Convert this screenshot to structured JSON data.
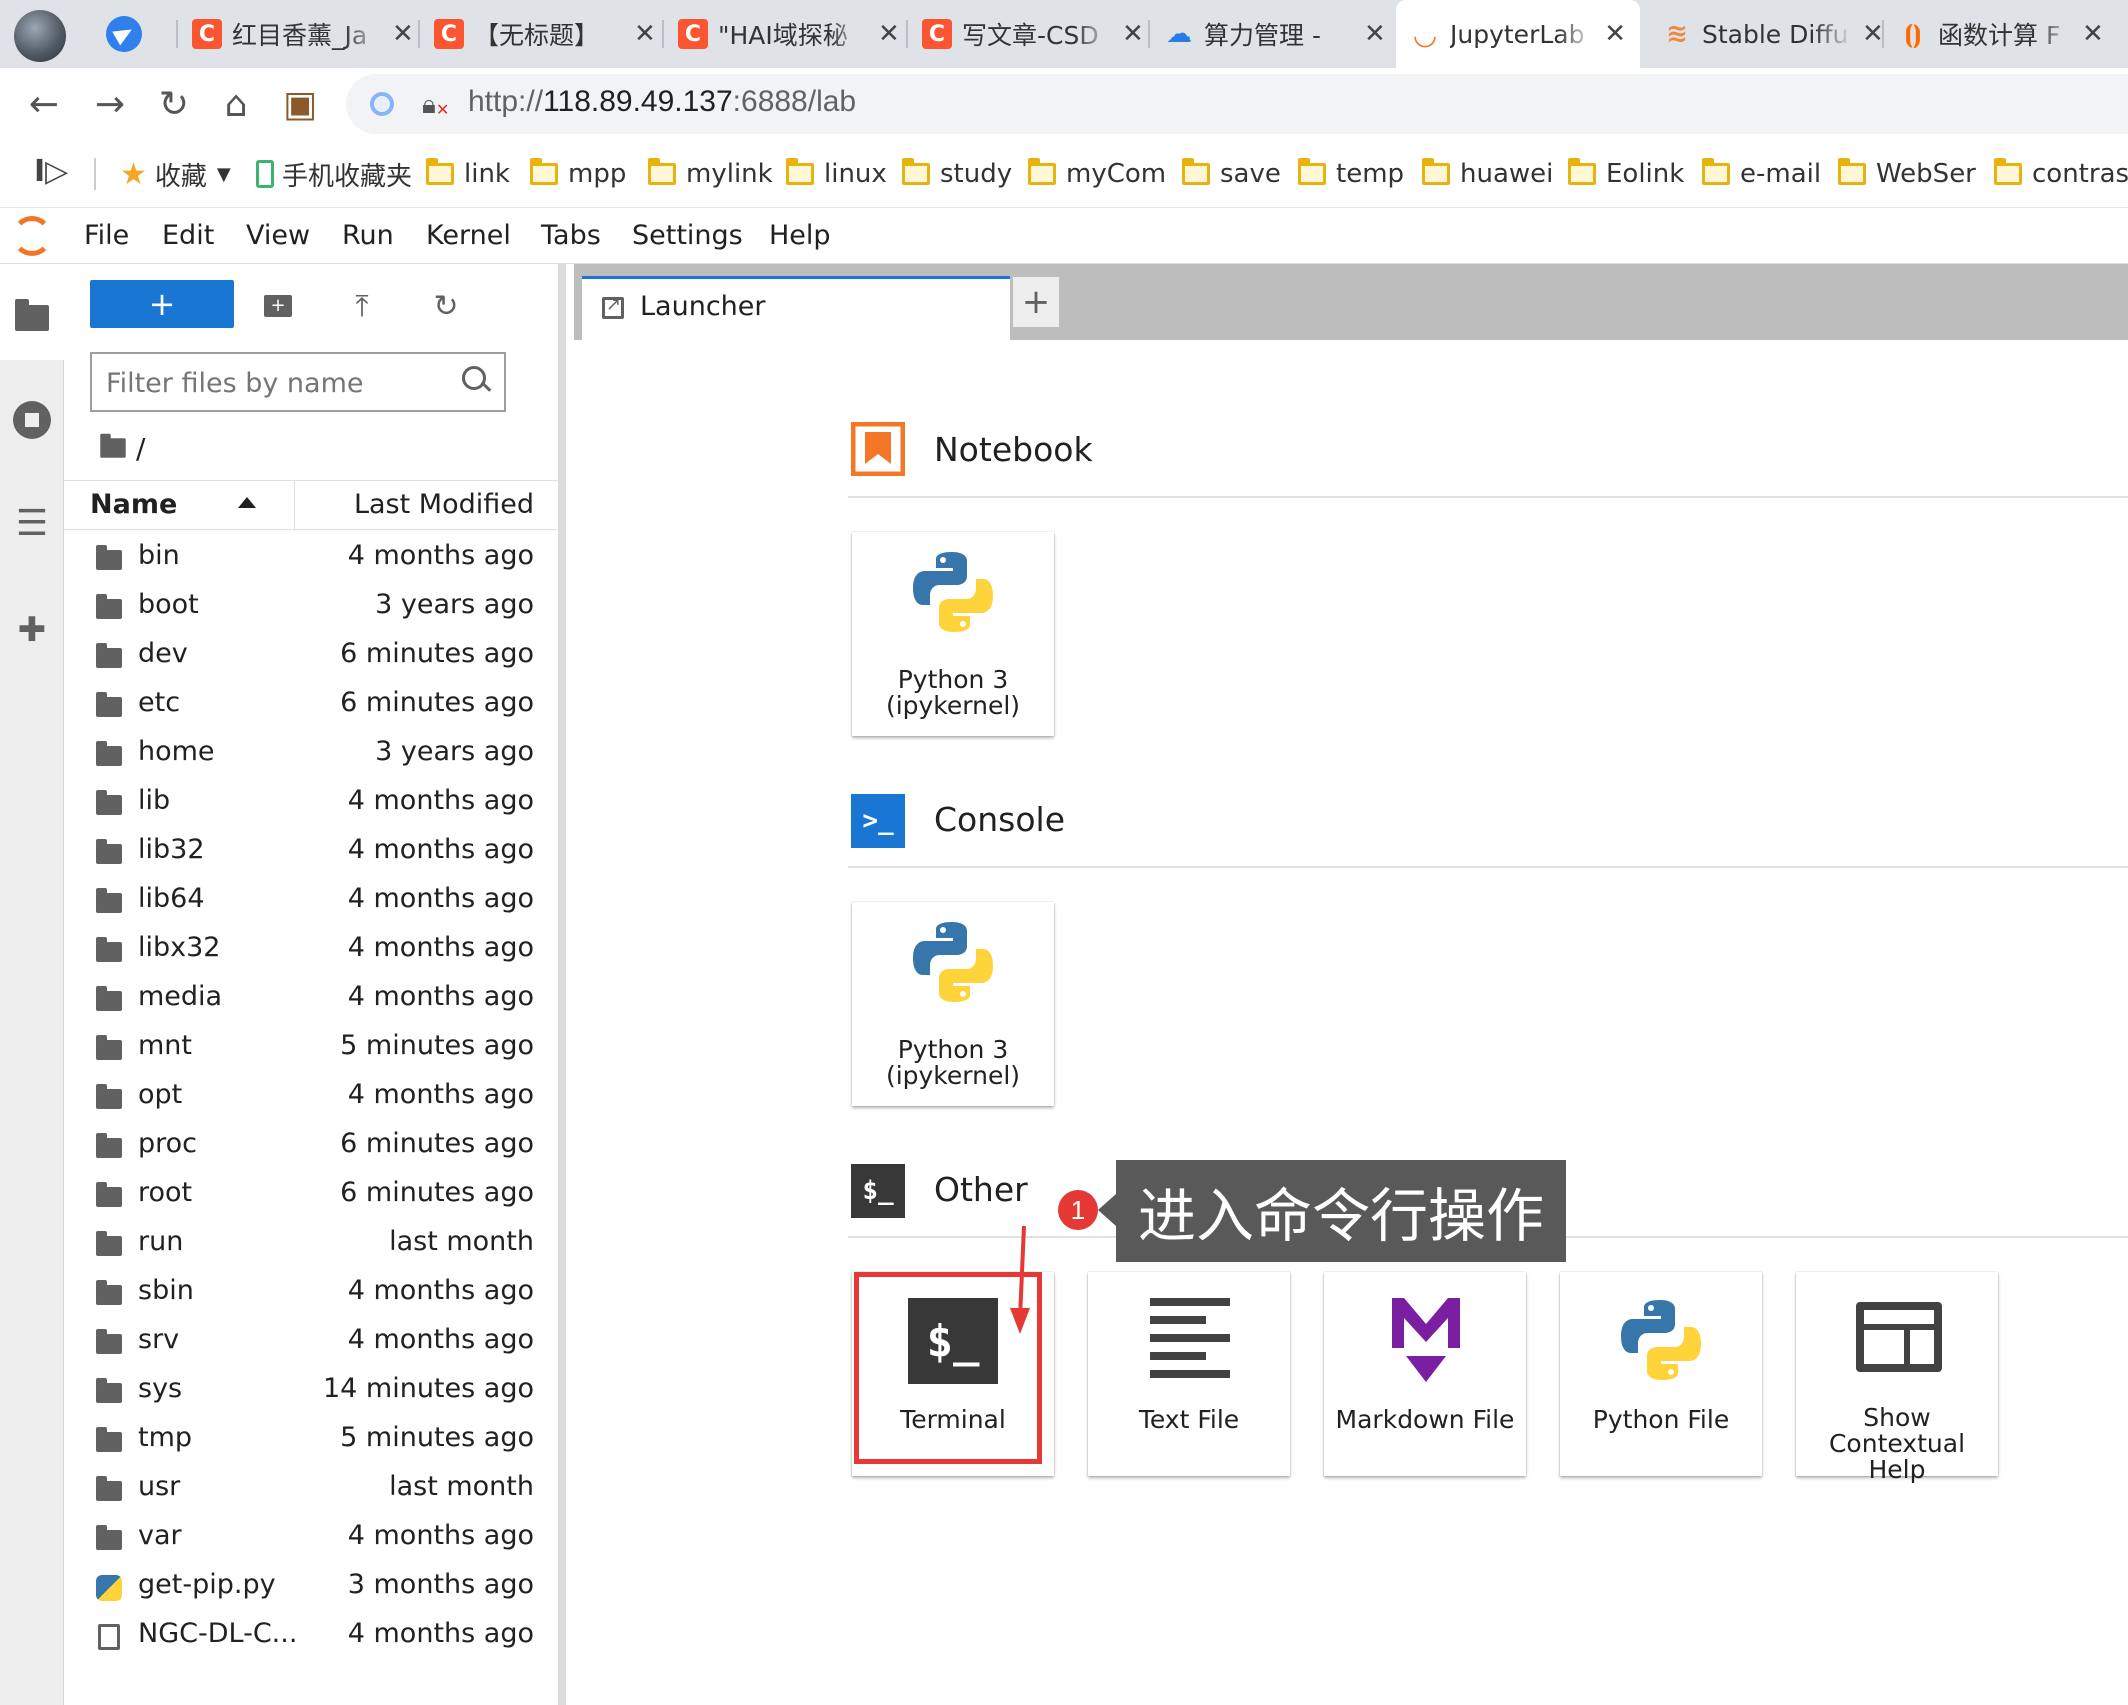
{
  "browser": {
    "tabs": [
      {
        "icon": "csdn-icon",
        "label": "红目香薰_Ja",
        "active": false
      },
      {
        "icon": "csdn-icon",
        "label": "【无标题】",
        "active": false
      },
      {
        "icon": "csdn-icon",
        "label": "\"HAI域探秘",
        "active": false
      },
      {
        "icon": "csdn-icon",
        "label": "写文章-CSD",
        "active": false
      },
      {
        "icon": "cloud-icon",
        "label": "算力管理 -",
        "active": false
      },
      {
        "icon": "jupyter-icon",
        "label": "JupyterLab",
        "active": true
      },
      {
        "icon": "stable-diffusion-icon",
        "label": "Stable Diffu",
        "active": false
      },
      {
        "icon": "function-compute-icon",
        "label": "函数计算 F",
        "active": false
      }
    ],
    "close_glyph": "✕",
    "url": {
      "prefix": "http://",
      "host": "118.89.49.137",
      "rest": ":6888/lab"
    },
    "bookmarks": {
      "favorites": "收藏",
      "mobile": "手机收藏夹",
      "folders": [
        "link",
        "mpp",
        "mylink",
        "linux",
        "study",
        "myCom",
        "save",
        "temp",
        "huawei",
        "Eolink",
        "e-mail",
        "WebSer",
        "contrast"
      ]
    }
  },
  "jupyter": {
    "menu": [
      "File",
      "Edit",
      "View",
      "Run",
      "Kernel",
      "Tabs",
      "Settings",
      "Help"
    ],
    "file_browser": {
      "new_button": "+",
      "filter_placeholder": "Filter files by name",
      "breadcrumb": "/",
      "columns": {
        "name": "Name",
        "modified": "Last Modified"
      },
      "items": [
        {
          "name": "bin",
          "modified": "4 months ago",
          "type": "folder"
        },
        {
          "name": "boot",
          "modified": "3 years ago",
          "type": "folder"
        },
        {
          "name": "dev",
          "modified": "6 minutes ago",
          "type": "folder"
        },
        {
          "name": "etc",
          "modified": "6 minutes ago",
          "type": "folder"
        },
        {
          "name": "home",
          "modified": "3 years ago",
          "type": "folder"
        },
        {
          "name": "lib",
          "modified": "4 months ago",
          "type": "folder"
        },
        {
          "name": "lib32",
          "modified": "4 months ago",
          "type": "folder"
        },
        {
          "name": "lib64",
          "modified": "4 months ago",
          "type": "folder"
        },
        {
          "name": "libx32",
          "modified": "4 months ago",
          "type": "folder"
        },
        {
          "name": "media",
          "modified": "4 months ago",
          "type": "folder"
        },
        {
          "name": "mnt",
          "modified": "5 minutes ago",
          "type": "folder"
        },
        {
          "name": "opt",
          "modified": "4 months ago",
          "type": "folder"
        },
        {
          "name": "proc",
          "modified": "6 minutes ago",
          "type": "folder"
        },
        {
          "name": "root",
          "modified": "6 minutes ago",
          "type": "folder"
        },
        {
          "name": "run",
          "modified": "last month",
          "type": "folder"
        },
        {
          "name": "sbin",
          "modified": "4 months ago",
          "type": "folder"
        },
        {
          "name": "srv",
          "modified": "4 months ago",
          "type": "folder"
        },
        {
          "name": "sys",
          "modified": "14 minutes ago",
          "type": "folder"
        },
        {
          "name": "tmp",
          "modified": "5 minutes ago",
          "type": "folder"
        },
        {
          "name": "usr",
          "modified": "last month",
          "type": "folder"
        },
        {
          "name": "var",
          "modified": "4 months ago",
          "type": "folder"
        },
        {
          "name": "get-pip.py",
          "modified": "3 months ago",
          "type": "python"
        },
        {
          "name": "NGC-DL-C...",
          "modified": "4 months ago",
          "type": "file"
        }
      ]
    },
    "main_tab": {
      "label": "Launcher",
      "add": "+"
    },
    "launcher": {
      "notebook": {
        "title": "Notebook",
        "cards": [
          {
            "line1": "Python 3",
            "line2": "(ipykernel)"
          }
        ]
      },
      "console": {
        "title": "Console",
        "icon_text": ">_",
        "cards": [
          {
            "line1": "Python 3",
            "line2": "(ipykernel)"
          }
        ]
      },
      "other": {
        "title": "Other",
        "icon_text": "$_",
        "cards": {
          "terminal": {
            "label": "Terminal",
            "icon_text": "$_"
          },
          "text_file": {
            "label": "Text File"
          },
          "markdown_file": {
            "label": "Markdown File"
          },
          "python_file": {
            "label": "Python File"
          },
          "help": {
            "line1": "Show",
            "line2": "Contextual",
            "line3": "Help"
          }
        }
      }
    }
  },
  "annotation": {
    "number": "1",
    "text": "进入命令行操作",
    "color": "#e53935"
  }
}
